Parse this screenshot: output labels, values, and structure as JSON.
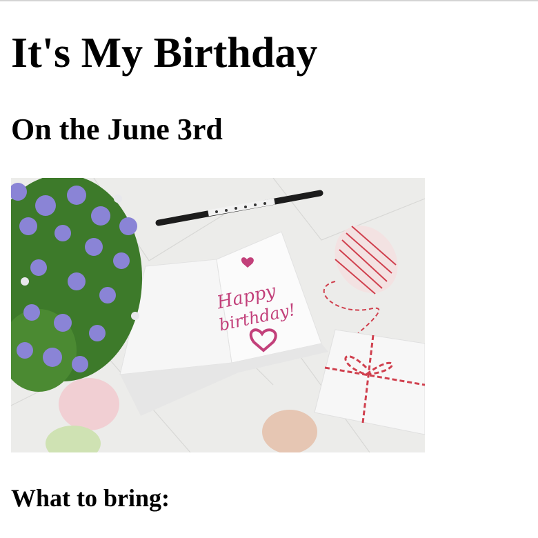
{
  "page": {
    "title": "It's My Birthday",
    "subtitle": "On the June 3rd",
    "bring_heading": "What to bring:"
  },
  "image": {
    "card_text_line1": "Happy",
    "card_text_line2": "birthday!",
    "colors": {
      "background": "#ececea",
      "card": "#fbfbfb",
      "card_script": "#c2407a",
      "flowers": "#8a84d6",
      "leaves": "#3d7a2a",
      "twine": "#d0404e",
      "macaron_pink": "#f1cfd3",
      "macaron_green": "#cfe2b3",
      "macaron_beige": "#e6c6b3"
    }
  }
}
